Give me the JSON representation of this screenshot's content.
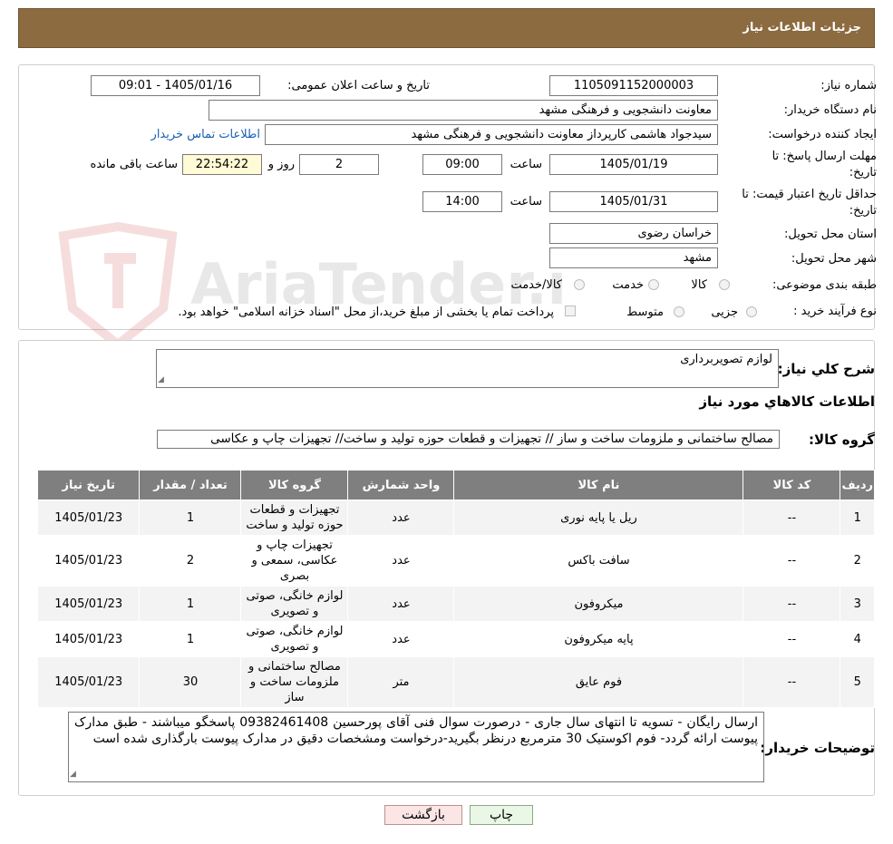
{
  "header": {
    "title": "جزئیات اطلاعات نیاز"
  },
  "watermark": {
    "text": "AriaTender.neT"
  },
  "form": {
    "need_number": {
      "label": "شماره نیاز:",
      "value": "1105091152000003"
    },
    "announce_datetime": {
      "label": "تاریخ و ساعت اعلان عمومی:",
      "value": "1405/01/16 - 09:01"
    },
    "buyer_org": {
      "label": "نام دستگاه خریدار:",
      "value": "معاونت دانشجویی و فرهنگی مشهد"
    },
    "requester": {
      "label": "ایجاد کننده درخواست:",
      "value": "سیدجواد هاشمی کارپرداز معاونت دانشجویی و فرهنگی مشهد",
      "contact_link": "اطلاعات تماس خریدار"
    },
    "reply_deadline": {
      "label_line1": "مهلت ارسال پاسخ: تا",
      "label_line2": "تاریخ:",
      "date": "1405/01/19",
      "time_label": "ساعت",
      "time": "09:00",
      "days": "2",
      "days_label": "روز و",
      "remaining": "22:54:22",
      "remaining_label": "ساعت باقی مانده"
    },
    "price_validity": {
      "label_line1": "حداقل تاریخ اعتبار قیمت: تا",
      "label_line2": "تاریخ:",
      "date": "1405/01/31",
      "time_label": "ساعت",
      "time": "14:00"
    },
    "province": {
      "label": "استان محل تحویل:",
      "value": "خراسان رضوی"
    },
    "city": {
      "label": "شهر محل تحویل:",
      "value": "مشهد"
    },
    "category": {
      "label": "طبقه بندی موضوعی:",
      "options": [
        "کالا",
        "خدمت",
        "کالا/خدمت"
      ]
    },
    "process": {
      "label": "نوع فرآیند خرید :",
      "options": [
        "جزیی",
        "متوسط"
      ],
      "note": "پرداخت تمام یا بخشی از مبلغ خرید،از محل \"اسناد خزانه اسلامی\" خواهد بود."
    }
  },
  "summary": {
    "label": "شرح کلي نياز:",
    "value": "لوازم تصویربرداری",
    "items_title": "اطلاعات کالاهاي مورد نياز",
    "group_label": "گروه کالا:",
    "group_value": "مصالح ساختمانی و ملزومات ساخت و ساز // تجهیزات و قطعات حوزه تولید و ساخت// تجهیزات چاپ و عکاسی"
  },
  "table": {
    "headers": [
      "رديف",
      "کد کالا",
      "نام کالا",
      "واحد شمارش",
      "گروه کالا",
      "تعداد / مقدار",
      "تاریخ نیاز"
    ],
    "rows": [
      {
        "idx": "1",
        "code": "--",
        "name": "ریل یا پایه نوری",
        "unit": "عدد",
        "group": "تجهیزات و قطعات حوزه تولید و ساخت",
        "qty": "1",
        "date": "1405/01/23"
      },
      {
        "idx": "2",
        "code": "--",
        "name": "سافت باکس",
        "unit": "عدد",
        "group": "تجهیزات چاپ و عکاسی، سمعی و بصری",
        "qty": "2",
        "date": "1405/01/23"
      },
      {
        "idx": "3",
        "code": "--",
        "name": "میکروفون",
        "unit": "عدد",
        "group": "لوازم خانگی، صوتی و تصویری",
        "qty": "1",
        "date": "1405/01/23"
      },
      {
        "idx": "4",
        "code": "--",
        "name": "پایه میکروفون",
        "unit": "عدد",
        "group": "لوازم خانگی، صوتی و تصویری",
        "qty": "1",
        "date": "1405/01/23"
      },
      {
        "idx": "5",
        "code": "--",
        "name": "فوم عایق",
        "unit": "متر",
        "group": "مصالح ساختمانی و ملزومات ساخت و ساز",
        "qty": "30",
        "date": "1405/01/23"
      }
    ]
  },
  "buyer_notes": {
    "label": "توضیحات خریدار:",
    "value": "ارسال رایگان - تسویه تا انتهای سال جاری - درصورت سوال فنی آقای پورحسین 09382461408 پاسخگو میباشند - طبق مدارک پیوست ارائه گردد- فوم اکوستیک 30 مترمربع درنظر بگیرید-درخواست ومشخصات دقیق در مدارک پیوست بارگذاری شده است"
  },
  "buttons": {
    "print": "چاپ",
    "back": "بازگشت"
  }
}
